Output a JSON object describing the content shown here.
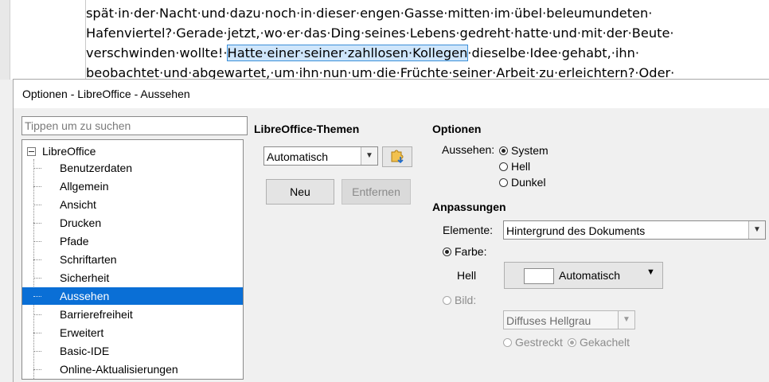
{
  "document": {
    "lines": [
      "spät·in·der·Nacht·und·dazu·noch·in·dieser·engen·Gasse·mitten·im·übel·beleumundeten·",
      "Hafenviertel?·Gerade·jetzt,·wo·er·das·Ding·seines·Lebens·gedreht·hatte·und·mit·der·Beute·",
      "beobachtet·und·abgewartet,·um·ihn·nun·um·die·Früchte·seiner·Arbeit·zu·erleichtern?·Oder·"
    ],
    "line3_before": "verschwinden·wollte!·",
    "line3_selected": "Hatte·einer·seiner·zahllosen·Kollegen",
    "line3_after": "·dieselbe·Idee·gehabt,·ihn·"
  },
  "dialog": {
    "title": "Optionen - LibreOffice - Aussehen",
    "search_placeholder": "Tippen um zu suchen",
    "tree": {
      "root": "LibreOffice",
      "items": [
        "Benutzerdaten",
        "Allgemein",
        "Ansicht",
        "Drucken",
        "Pfade",
        "Schriftarten",
        "Sicherheit",
        "Aussehen",
        "Barrierefreiheit",
        "Erweitert",
        "Basic-IDE",
        "Online-Aktualisierungen"
      ],
      "selected": "Aussehen"
    },
    "themes": {
      "heading": "LibreOffice-Themen",
      "selected": "Automatisch",
      "new_button": "Neu",
      "remove_button": "Entfernen",
      "icon": "puzzle-download-icon"
    },
    "options": {
      "heading": "Optionen",
      "appearance_label": "Aussehen:",
      "appearance_options": [
        "System",
        "Hell",
        "Dunkel"
      ],
      "appearance_selected": "System"
    },
    "customizations": {
      "heading": "Anpassungen",
      "elements_label": "Elemente:",
      "elements_value": "Hintergrund des Dokuments",
      "color_radio": "Farbe:",
      "light_label": "Hell",
      "color_value": "Automatisch",
      "image_radio": "Bild:",
      "image_value": "Diffuses Hellgrau",
      "stretched": "Gestreckt",
      "tiled": "Gekachelt"
    }
  },
  "colors": {
    "selection": "#0a6fd6",
    "text_highlight": "#cfe6fb"
  }
}
